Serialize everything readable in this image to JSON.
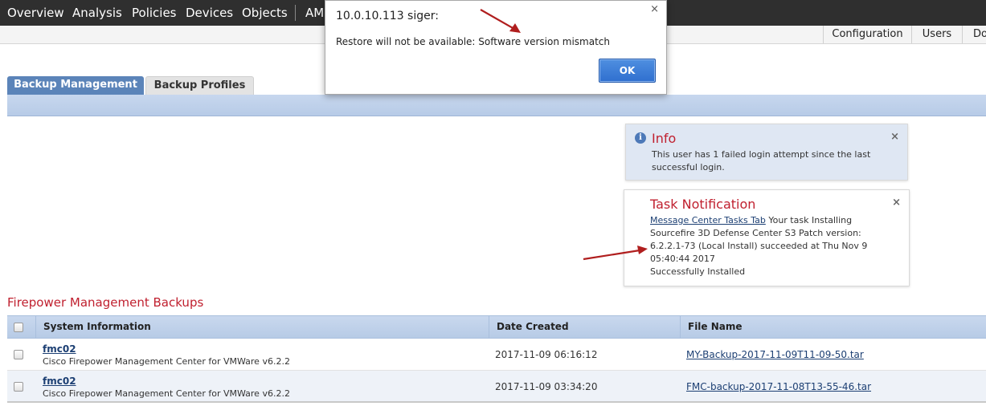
{
  "topnav": {
    "items": [
      "Overview",
      "Analysis",
      "Policies",
      "Devices",
      "Objects",
      "AM"
    ]
  },
  "subnav": {
    "items": [
      "Configuration",
      "Users",
      "Do"
    ]
  },
  "tabs": {
    "active": "Backup Management",
    "inactive": "Backup Profiles"
  },
  "info_panel": {
    "title": "Info",
    "text": "This user has 1 failed login attempt since the last successful login.",
    "icon": "info-icon"
  },
  "task_panel": {
    "title": "Task Notification",
    "link": "Message Center Tasks Tab",
    "text": " Your task Installing Sourcefire 3D Defense Center S3 Patch version: 6.2.2.1-73 (Local Install) succeeded at Thu Nov 9 05:40:44 2017",
    "status": "Successfully Installed"
  },
  "section": {
    "title": "Firepower Management Backups"
  },
  "table": {
    "columns": [
      "System Information",
      "Date Created",
      "File Name"
    ],
    "rows": [
      {
        "name": "fmc02",
        "desc": "Cisco Firepower Management Center for VMWare v6.2.2",
        "date": "2017-11-09 06:16:12",
        "file": "MY-Backup-2017-11-09T11-09-50.tar"
      },
      {
        "name": "fmc02",
        "desc": "Cisco Firepower Management Center for VMWare v6.2.2",
        "date": "2017-11-09 03:34:20",
        "file": "FMC-backup-2017-11-08T13-55-46.tar"
      }
    ]
  },
  "dialog": {
    "title": "10.0.10.113 siger:",
    "message": "Restore will not be available: Software version mismatch",
    "ok": "OK",
    "close": "×"
  },
  "colors": {
    "nav_bg": "#2f2f2f",
    "tab_active": "#5b84b9",
    "accent_red": "#c0202f",
    "link": "#1c3f73",
    "ok_button": "#2f6fcf",
    "arrow": "#b01e1e"
  }
}
